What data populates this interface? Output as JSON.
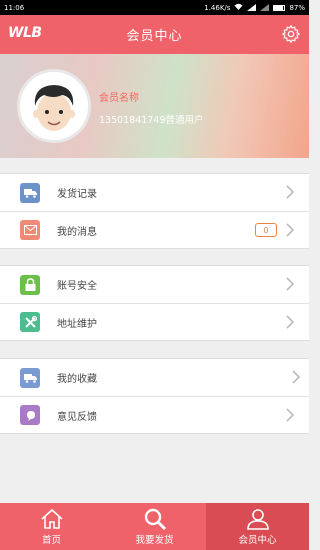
{
  "statusbar": {
    "time": "11:06",
    "speed": "1.46K/s",
    "battery": "87%"
  },
  "header": {
    "logo": "WLB",
    "title": "会员中心"
  },
  "profile": {
    "name": "会员名称",
    "phone_type": "13501841749普通用户"
  },
  "menu": {
    "shipping_records": "发货记录",
    "my_messages": "我的消息",
    "message_count": "0",
    "account_security": "账号安全",
    "address_maintenance": "地址维护",
    "my_favorites": "我的收藏",
    "feedback": "意见反馈"
  },
  "tabs": {
    "home": "首页",
    "ship": "我要发货",
    "member": "会员中心"
  },
  "colors": {
    "primary": "#f0626a",
    "active_tab": "#d94c53",
    "badge": "#e98448"
  }
}
